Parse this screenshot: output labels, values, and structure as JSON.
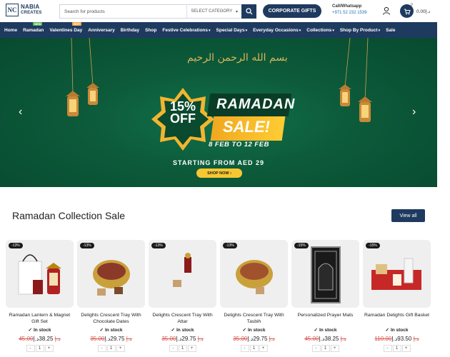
{
  "header": {
    "logo_mark": "NC",
    "logo_line1": "NABIA",
    "logo_line2": "CREATES",
    "search_placeholder": "Search for products",
    "category_label": "SELECT CATEGORY",
    "corporate_label": "CORPORATE GIFTS",
    "call_label": "Call/Whatsapp",
    "call_number": "+971 52 232 1539",
    "cart_count": "0",
    "cart_total": "0.00د.إ"
  },
  "nav": {
    "items": [
      {
        "label": "Home"
      },
      {
        "label": "Ramadan",
        "badge": "NEW"
      },
      {
        "label": "Valentines Day",
        "badge": "HOT"
      },
      {
        "label": "Anniversary"
      },
      {
        "label": "Birthday"
      },
      {
        "label": "Shop"
      },
      {
        "label": "Festive Celebrations",
        "dropdown": true
      },
      {
        "label": "Special Days",
        "dropdown": true
      },
      {
        "label": "Everyday Occasions",
        "dropdown": true
      },
      {
        "label": "Collections",
        "dropdown": true
      },
      {
        "label": "Shop By Product",
        "dropdown": true
      },
      {
        "label": "Sale"
      }
    ]
  },
  "hero": {
    "bismillah": "بسم الله الرحمن الرحيم",
    "percent": "15%",
    "off": "OFF",
    "ramadan": "RAMADAN",
    "sale": "SALE!",
    "dates": "8 FEB TO 12 FEB",
    "starting": "STARTING FROM AED 29",
    "shop_now": "SHOP NOW ›",
    "prev_arrow": "‹",
    "next_arrow": "›"
  },
  "section": {
    "title": "Ramadan Collection Sale",
    "view_all": "View all"
  },
  "products": [
    {
      "discount": "-13%",
      "name": "Ramadan Lantern & Magnet Gift Set",
      "stock": "In stock",
      "old_price": "45.00د.إ",
      "new_price": "38.25د.إ",
      "qty": "1"
    },
    {
      "discount": "-13%",
      "name": "Delights Crescent Tray With Chocolate Dates",
      "stock": "In stock",
      "old_price": "35.00د.إ",
      "new_price": "29.75د.إ",
      "qty": "1"
    },
    {
      "discount": "-13%",
      "name": "Delights Crescent Tray With Attar",
      "stock": "In stock",
      "old_price": "35.00د.إ",
      "new_price": "29.75د.إ",
      "qty": "1"
    },
    {
      "discount": "-13%",
      "name": "Delights Crescent Tray With Tasbih",
      "stock": "In stock",
      "old_price": "35.00د.إ",
      "new_price": "29.75د.إ",
      "qty": "1"
    },
    {
      "discount": "-15%",
      "name": "Personalized Prayer Mats",
      "stock": "In stock",
      "old_price": "45.00د.إ",
      "new_price": "38.25د.إ",
      "qty": "1"
    },
    {
      "discount": "-15%",
      "name": "Ramadan Delights Gift Basket",
      "stock": "In stock",
      "old_price": "110.00د.إ",
      "new_price": "93.50د.إ",
      "qty": "1"
    }
  ],
  "colors": {
    "navy": "#1f3a5f",
    "green": "#0c5a3a",
    "gold": "#f7c731",
    "sale_red": "#d9534f"
  }
}
